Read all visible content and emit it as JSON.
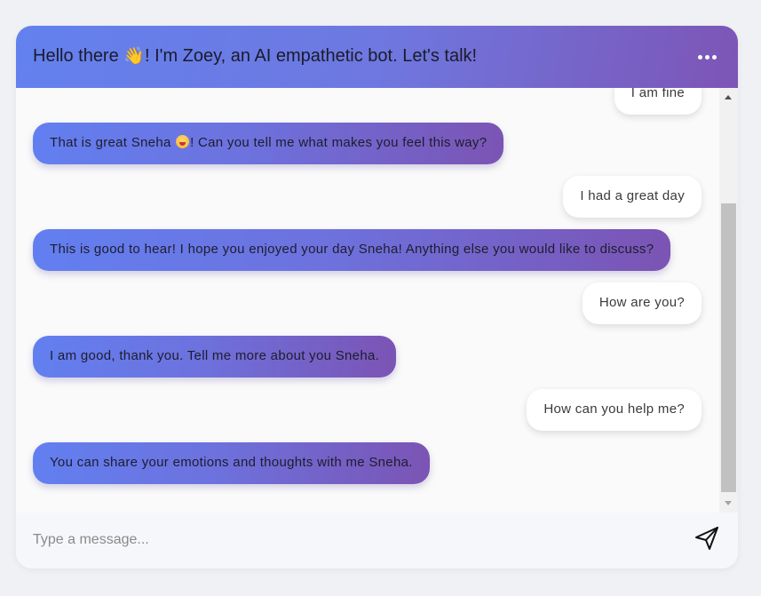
{
  "header": {
    "title_prefix": "Hello there",
    "title_emoji": "👋",
    "title_suffix": "! I'm Zoey, an AI empathetic bot. Let's talk!",
    "menu_icon": "more-horizontal-icon"
  },
  "messages": [
    {
      "sender": "user",
      "text": "I am fine"
    },
    {
      "sender": "bot",
      "text_before": "That is great Sneha ",
      "emoji": "smiling-face-emoji",
      "text_after": "! Can you tell me what makes you feel this way?"
    },
    {
      "sender": "user",
      "text": "I had a great day"
    },
    {
      "sender": "bot",
      "text": "This is good to hear! I hope you enjoyed your day Sneha! Anything else you would like to discuss?"
    },
    {
      "sender": "user",
      "text": "How are you?"
    },
    {
      "sender": "bot",
      "text": "I am good, thank you. Tell me more about you Sneha."
    },
    {
      "sender": "user",
      "text": "How can you help me?"
    },
    {
      "sender": "bot",
      "text": "You can share your emotions and thoughts with me Sneha."
    }
  ],
  "input": {
    "placeholder": "Type a message...",
    "value": "",
    "send_icon": "send-icon"
  },
  "colors": {
    "header_gradient_start": "#6381ee",
    "header_gradient_end": "#7d55b6",
    "bot_bubble_start": "#627ff0",
    "bot_bubble_end": "#7b54b4",
    "user_bubble": "#ffffff",
    "background": "#f0f1f4"
  }
}
